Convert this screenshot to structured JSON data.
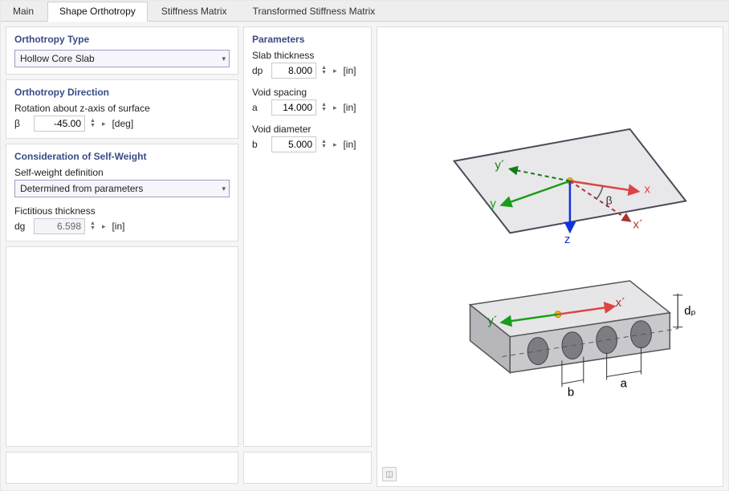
{
  "tabs": {
    "main": "Main",
    "shape": "Shape Orthotropy",
    "stiff": "Stiffness Matrix",
    "trans": "Transformed Stiffness Matrix"
  },
  "left": {
    "ortho_type_title": "Orthotropy Type",
    "ortho_type_value": "Hollow Core Slab",
    "direction_title": "Orthotropy Direction",
    "direction_label": "Rotation about z-axis of surface",
    "beta_sym": "β",
    "beta_value": "-45.00",
    "beta_unit": "[deg]",
    "selfweight_title": "Consideration of Self-Weight",
    "selfweight_label": "Self-weight definition",
    "selfweight_value": "Determined from parameters",
    "fict_label": "Fictitious thickness",
    "dg_sym": "dg",
    "dg_value": "6.598",
    "dg_unit": "[in]"
  },
  "params": {
    "title": "Parameters",
    "slab_label": "Slab thickness",
    "dp_sym": "dp",
    "dp_value": "8.000",
    "dp_unit": "[in]",
    "void_spacing_label": "Void spacing",
    "a_sym": "a",
    "a_value": "14.000",
    "a_unit": "[in]",
    "void_dia_label": "Void diameter",
    "b_sym": "b",
    "b_value": "5.000",
    "b_unit": "[in]"
  },
  "preview": {
    "labels": {
      "x": "x",
      "x2": "x´",
      "y": "y",
      "y2": "y´",
      "z": "z",
      "beta": "β",
      "dp": "dₚ",
      "a": "a",
      "b": "b"
    }
  }
}
